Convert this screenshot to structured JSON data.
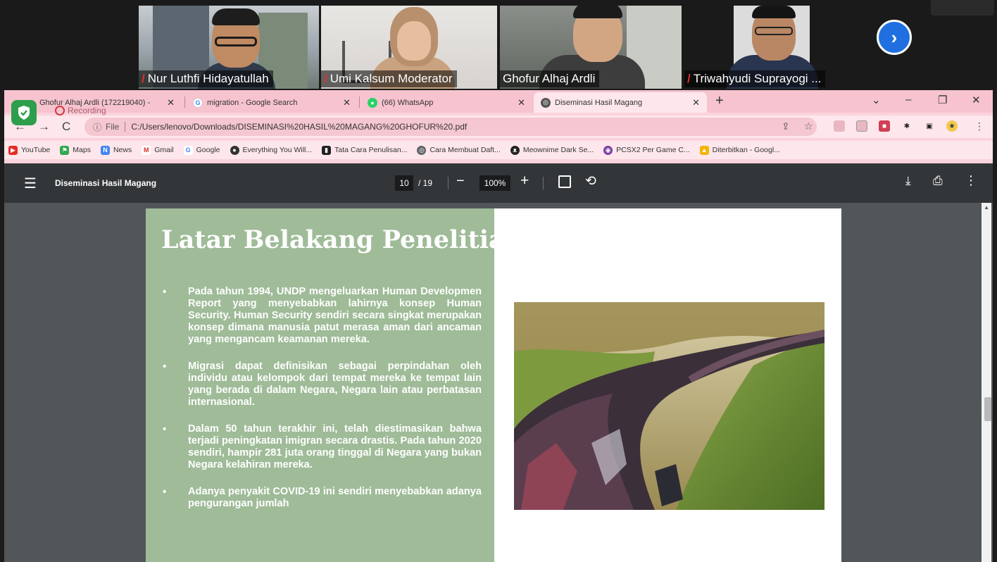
{
  "zoom": {
    "participants": [
      {
        "name": "Nur Luthfi Hidayatullah",
        "muted": true,
        "active": false
      },
      {
        "name": "Umi Kalsum Moderator",
        "muted": true,
        "active": false
      },
      {
        "name": "Ghofur Alhaj Ardli",
        "muted": false,
        "active": true
      },
      {
        "name": "Triwahyudi Suprayogi ...",
        "muted": true,
        "active": false
      }
    ],
    "next_icon": "chevron-right-icon",
    "recording_label": "Recording"
  },
  "browser": {
    "tabs": [
      {
        "label": "Ghofur Alhaj Ardli (172219040) -",
        "icon": "zoom-icon",
        "active": false
      },
      {
        "label": "migration - Google Search",
        "icon": "google-icon",
        "active": false
      },
      {
        "label": "(66) WhatsApp",
        "icon": "whatsapp-icon",
        "active": false
      },
      {
        "label": "Diseminasi Hasil Magang",
        "icon": "globe-icon",
        "active": true
      }
    ],
    "address": {
      "scheme": "File",
      "url": "C:/Users/lenovo/Downloads/DISEMINASI%20HASIL%20MAGANG%20GHOFUR%20.pdf"
    },
    "bookmarks": [
      {
        "label": "YouTube",
        "color": "#e52d27"
      },
      {
        "label": "Maps",
        "color": "#34a853"
      },
      {
        "label": "News",
        "color": "#4285f4"
      },
      {
        "label": "Gmail",
        "color": "#d93025"
      },
      {
        "label": "Google",
        "color": "#4285f4"
      },
      {
        "label": "Everything You Will...",
        "color": "#333333"
      },
      {
        "label": "Tata Cara Penulisan...",
        "color": "#222222"
      },
      {
        "label": "Cara Membuat Daft...",
        "color": "#5f6368"
      },
      {
        "label": "Meownime Dark Se...",
        "color": "#222222"
      },
      {
        "label": "PCSX2 Per Game C...",
        "color": "#7b3fa0"
      },
      {
        "label": "Diterbitkan - Googl...",
        "color": "#f4b400"
      }
    ]
  },
  "pdf": {
    "title": "Diseminasi Hasil Magang",
    "current_page": "10",
    "total_pages": "/ 19",
    "zoom": "100%"
  },
  "slide": {
    "title": "Latar Belakang Penelitian",
    "bullets": [
      "Pada tahun 1994, UNDP mengeluarkan Human Developmen Report yang menyebabkan lahirnya konsep Human Security. Human Security sendiri secara singkat merupakan konsep dimana manusia patut merasa aman dari ancaman yang mengancam keamanan mereka.",
      "Migrasi dapat definisikan sebagai perpindahan oleh individu atau kelompok dari tempat mereka ke tempat lain yang berada di dalam Negara, Negara lain atau perbatasan internasional.",
      "Dalam 50 tahun terakhir ini, telah diestimasikan bahwa terjadi peningkatan imigran secara drastis. Pada tahun 2020 sendiri, hampir 281 juta orang tinggal di Negara yang bukan Negara kelahiran mereka.",
      "Adanya penyakit COVID-19 ini sendiri menyebabkan adanya pengurangan jumlah"
    ]
  },
  "colors": {
    "slide_green": "#9fbb98",
    "tab_bar": "#f6c3cf",
    "pdf_toolbar": "#323639"
  }
}
